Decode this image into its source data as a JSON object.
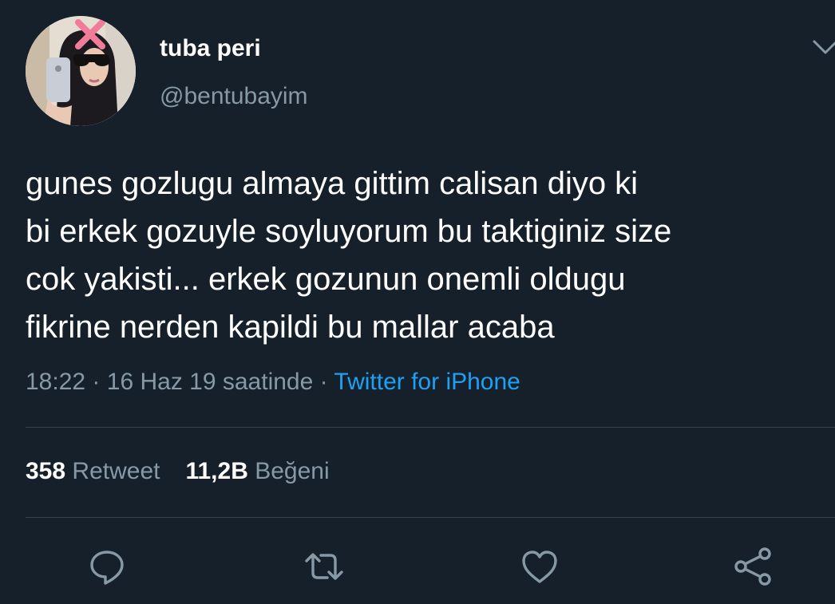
{
  "author": {
    "display_name": "tuba peri",
    "handle": "@bentubayim",
    "avatar_icon": "profile-photo"
  },
  "tweet": {
    "lines": [
      "gunes gozlugu almaya gittim calisan diyo ki",
      "bi erkek gozuyle soyluyorum bu taktiginiz size",
      "cok yakisti... erkek gozunun onemli oldugu",
      "fikrine nerden kapildi bu mallar acaba"
    ]
  },
  "meta": {
    "time": "18:22",
    "separator": "·",
    "date": "16 Haz 19 saatinde",
    "source": "Twitter for iPhone"
  },
  "stats": {
    "retweets_count": "358",
    "retweets_label": "Retweet",
    "likes_count": "11,2B",
    "likes_label": "Beğeni"
  },
  "actions": {
    "reply_icon": "reply-icon",
    "retweet_icon": "retweet-icon",
    "like_icon": "heart-icon",
    "share_icon": "share-icon"
  },
  "colors": {
    "background": "#15202b",
    "secondary_text": "#8899a6",
    "link": "#1da1f2",
    "divider": "#38444d"
  }
}
